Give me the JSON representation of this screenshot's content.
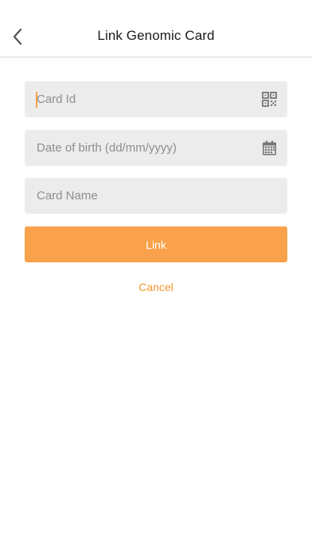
{
  "header": {
    "title": "Link Genomic Card",
    "back_icon": "chevron-left-icon"
  },
  "form": {
    "card_id": {
      "value": "",
      "placeholder": "Card Id",
      "icon": "qr-code-icon"
    },
    "date_of_birth": {
      "value": "",
      "placeholder": "Date of birth (dd/mm/yyyy)",
      "icon": "calendar-icon"
    },
    "card_name": {
      "value": "",
      "placeholder": "Card Name"
    }
  },
  "actions": {
    "link_label": "Link",
    "cancel_label": "Cancel"
  },
  "colors": {
    "accent": "#f9a24b",
    "field_background": "#ececec"
  }
}
